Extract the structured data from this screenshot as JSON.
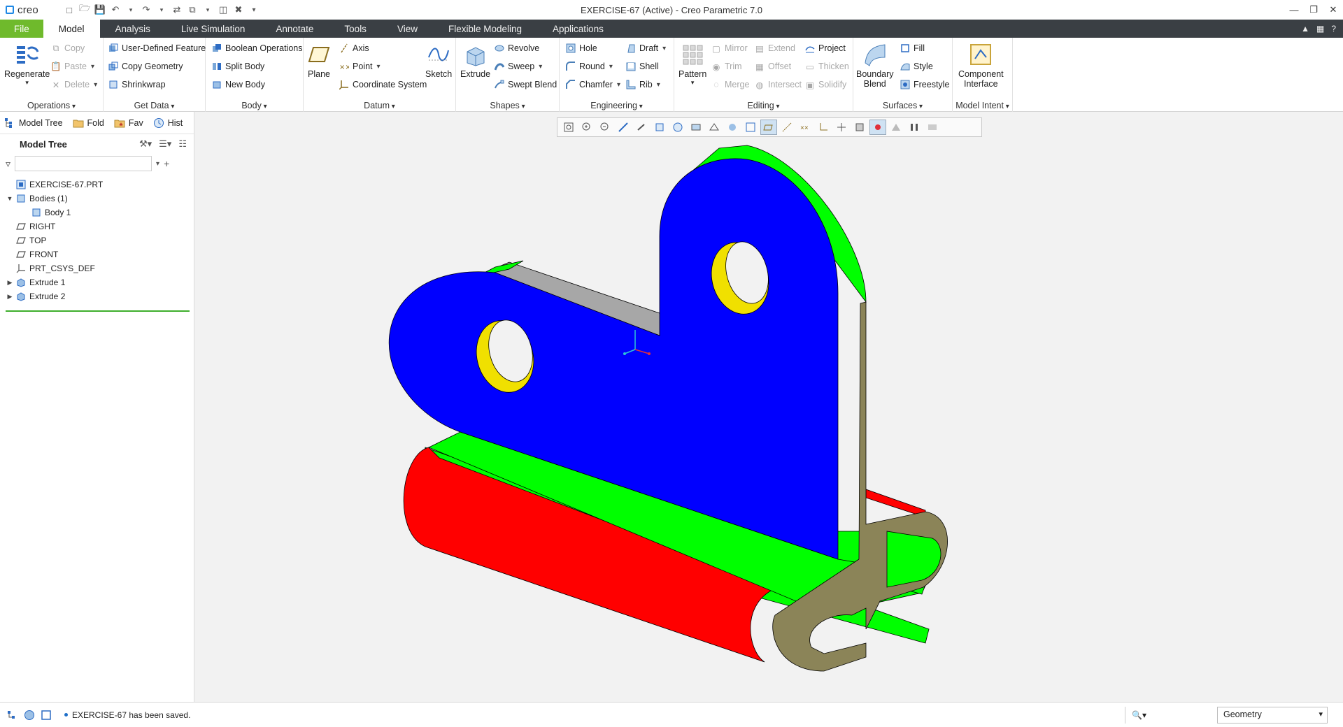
{
  "app": {
    "logo_text": "creo",
    "title": "EXERCISE-67 (Active) - Creo Parametric 7.0"
  },
  "menu": {
    "tabs": [
      "File",
      "Model",
      "Analysis",
      "Live Simulation",
      "Annotate",
      "Tools",
      "View",
      "Flexible Modeling",
      "Applications"
    ],
    "active_tab": "Model"
  },
  "ribbon": {
    "operations": {
      "label": "Operations",
      "regenerate": "Regenerate",
      "copy": "Copy",
      "paste": "Paste",
      "delete": "Delete"
    },
    "get_data": {
      "label": "Get Data",
      "user_defined_feature": "User-Defined Feature",
      "copy_geometry": "Copy Geometry",
      "shrinkwrap": "Shrinkwrap"
    },
    "body": {
      "label": "Body",
      "boolean_operations": "Boolean Operations",
      "split_body": "Split Body",
      "new_body": "New Body"
    },
    "datum": {
      "label": "Datum",
      "plane": "Plane",
      "axis": "Axis",
      "point": "Point",
      "coordinate_system": "Coordinate System",
      "sketch": "Sketch"
    },
    "shapes": {
      "label": "Shapes",
      "extrude": "Extrude",
      "revolve": "Revolve",
      "sweep": "Sweep",
      "swept_blend": "Swept Blend"
    },
    "engineering": {
      "label": "Engineering",
      "hole": "Hole",
      "round": "Round",
      "chamfer": "Chamfer",
      "draft": "Draft",
      "shell": "Shell",
      "rib": "Rib"
    },
    "editing": {
      "label": "Editing",
      "pattern": "Pattern",
      "mirror": "Mirror",
      "trim": "Trim",
      "merge": "Merge",
      "extend": "Extend",
      "offset": "Offset",
      "intersect": "Intersect",
      "project": "Project",
      "thicken": "Thicken",
      "solidify": "Solidify"
    },
    "surfaces": {
      "label": "Surfaces",
      "boundary_blend_1": "Boundary",
      "boundary_blend_2": "Blend",
      "fill": "Fill",
      "style": "Style",
      "freestyle": "Freestyle"
    },
    "model_intent": {
      "label": "Model Intent",
      "component_interface_1": "Component",
      "component_interface_2": "Interface"
    }
  },
  "left_panel": {
    "tabs": [
      "Model Tree",
      "Fold",
      "Fav",
      "Hist"
    ],
    "header": "Model Tree",
    "search_placeholder": "",
    "tree": [
      {
        "label": "EXERCISE-67.PRT",
        "indent": 0,
        "expander": "",
        "icon": "part-icon"
      },
      {
        "label": "Bodies (1)",
        "indent": 0,
        "expander": "open",
        "icon": "bodies-icon"
      },
      {
        "label": "Body 1",
        "indent": 1,
        "expander": "",
        "icon": "body-icon"
      },
      {
        "label": "RIGHT",
        "indent": 0,
        "expander": "",
        "icon": "datum-plane-icon"
      },
      {
        "label": "TOP",
        "indent": 0,
        "expander": "",
        "icon": "datum-plane-icon"
      },
      {
        "label": "FRONT",
        "indent": 0,
        "expander": "",
        "icon": "datum-plane-icon"
      },
      {
        "label": "PRT_CSYS_DEF",
        "indent": 0,
        "expander": "",
        "icon": "csys-icon"
      },
      {
        "label": "Extrude 1",
        "indent": 0,
        "expander": "closed",
        "icon": "extrude-icon"
      },
      {
        "label": "Extrude 2",
        "indent": 0,
        "expander": "closed",
        "icon": "extrude-icon"
      }
    ]
  },
  "graphics_toolbar": {
    "icons": [
      "refit-icon",
      "zoom-in-icon",
      "zoom-out-icon",
      "repaint-icon",
      "pan-icon",
      "saved-orientations-icon",
      "view-manager-icon",
      "display-style-icon",
      "perspective-icon",
      "appearance-icon",
      "annotation-display-icon",
      "plane-display-icon",
      "axis-display-icon",
      "point-display-icon",
      "csys-display-icon",
      "spin-center-icon",
      "mode-toggle-icon",
      "mode-toggle-2-icon",
      "simulation-icon",
      "pause-icon",
      "layout-icon"
    ]
  },
  "colors": {
    "flange_face": "#0000ff",
    "top_faces": "#00ff00",
    "curl_face": "#ff0000",
    "hole_inner": "#f0e000",
    "side_faces": "#8b8458",
    "back_face": "#a7a7a7",
    "menubar_bg": "#3a3f44",
    "file_tab": "#6fba2c"
  },
  "status": {
    "message": "EXERCISE-67 has been saved.",
    "filter_value": "Geometry"
  }
}
